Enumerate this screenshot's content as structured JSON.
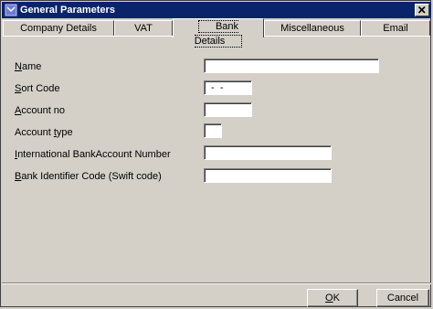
{
  "window": {
    "title": "General Parameters",
    "close_glyph": "×",
    "icon": "app-window-icon",
    "titlebar_color": "#0a246a"
  },
  "tabs": [
    {
      "label": "Company Details",
      "active": false
    },
    {
      "label": "VAT",
      "active": false
    },
    {
      "label": "Bank Details",
      "active": true
    },
    {
      "label": "Miscellaneous",
      "active": false
    },
    {
      "label": "Email",
      "active": false
    }
  ],
  "fields": {
    "name": {
      "label_first": "N",
      "label_rest": "ame",
      "value": ""
    },
    "sort_code": {
      "label_first": "S",
      "label_rest": "ort Code",
      "value": " -  - "
    },
    "account_no": {
      "label_first": "A",
      "label_rest": "ccount no",
      "value": ""
    },
    "account_type": {
      "label_prefix": "Account ",
      "label_first": "t",
      "label_rest": "ype",
      "value": ""
    },
    "iban": {
      "label_first": "I",
      "label_rest": "nternational BankAccount Number",
      "value": ""
    },
    "bic": {
      "label_first": "B",
      "label_rest": "ank Identifier Code (Swift code)",
      "value": ""
    }
  },
  "buttons": {
    "ok_first": "O",
    "ok_rest": "K",
    "cancel": "Cancel"
  }
}
